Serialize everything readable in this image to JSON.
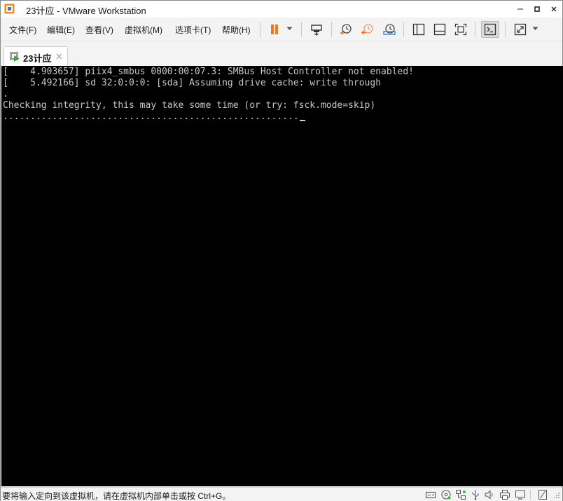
{
  "window": {
    "title": "23计应 - VMware Workstation"
  },
  "menu": {
    "items": [
      {
        "id": "file",
        "label": "文件(F)"
      },
      {
        "id": "edit",
        "label": "编辑(E)"
      },
      {
        "id": "view",
        "label": "查看(V)"
      },
      {
        "id": "vm",
        "label": "虚拟机(M)"
      },
      {
        "id": "tabs",
        "label": "选项卡(T)"
      },
      {
        "id": "help",
        "label": "帮助(H)"
      }
    ]
  },
  "toolbar": {
    "icons": [
      "pause-icon",
      "send-ctrl-alt-del-icon",
      "snapshot-take-icon",
      "snapshot-revert-icon",
      "snapshot-manager-icon",
      "library-view-icon",
      "thumbnail-view-icon",
      "fullscreen-icon",
      "console-view-icon",
      "stretch-view-icon"
    ],
    "accent_color": "#f07a24"
  },
  "tab": {
    "label": "23计应"
  },
  "console": {
    "lines": [
      "[    4.903657] piix4_smbus 0000:00:07.3: SMBus Host Controller not enabled!",
      "[    5.492166] sd 32:0:0:0: [sda] Assuming drive cache: write through",
      ".",
      "Checking integrity, this may take some time (or try: fsck.mode=skip)",
      "......................................................"
    ],
    "background": "#000000",
    "text_color": "#c8c8c8"
  },
  "statusbar": {
    "message": "要将输入定向到该虚拟机，请在虚拟机内部单击或按 Ctrl+G。",
    "icons": [
      "hard-disk-icon",
      "cd-dvd-icon",
      "network-icon",
      "usb-icon",
      "sound-icon",
      "printer-icon",
      "display-icon",
      "message-log-icon"
    ]
  }
}
